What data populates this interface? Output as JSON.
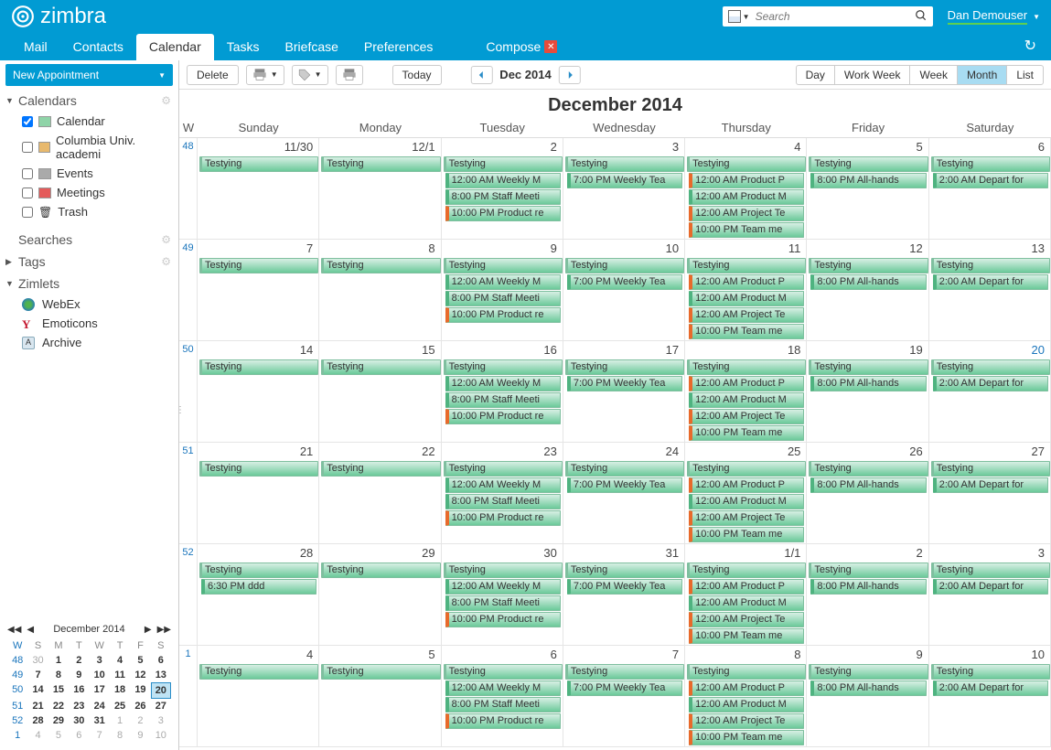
{
  "logo_text": "zimbra",
  "search": {
    "placeholder": "Search"
  },
  "user": {
    "name": "Dan Demouser"
  },
  "nav": {
    "mail": "Mail",
    "contacts": "Contacts",
    "calendar": "Calendar",
    "tasks": "Tasks",
    "briefcase": "Briefcase",
    "preferences": "Preferences",
    "compose": "Compose"
  },
  "new_appt": "New Appointment",
  "toolbar": {
    "delete": "Delete",
    "today": "Today",
    "month_label": "Dec 2014"
  },
  "views": {
    "day": "Day",
    "work_week": "Work Week",
    "week": "Week",
    "month": "Month",
    "list": "List"
  },
  "sidebar": {
    "calendars_header": "Calendars",
    "items": [
      {
        "label": "Calendar",
        "checked": true,
        "color": "#8fd4a8"
      },
      {
        "label": "Columbia Univ. academi",
        "checked": false,
        "color": "#e8b96d"
      },
      {
        "label": "Events",
        "checked": false,
        "color": "#aaaaaa"
      },
      {
        "label": "Meetings",
        "checked": false,
        "color": "#e45b5b"
      },
      {
        "label": "Trash",
        "checked": false,
        "color": "trash"
      }
    ],
    "searches": "Searches",
    "tags": "Tags",
    "zimlets": "Zimlets",
    "zimlet_items": [
      {
        "label": "WebEx",
        "icon": "globe"
      },
      {
        "label": "Emoticons",
        "icon": "yahoo"
      },
      {
        "label": "Archive",
        "icon": "archive"
      }
    ]
  },
  "mini": {
    "title": "December 2014",
    "head": [
      "W",
      "S",
      "M",
      "T",
      "W",
      "T",
      "F",
      "S"
    ],
    "rows": [
      {
        "wk": "48",
        "days": [
          {
            "n": "30",
            "m": true
          },
          {
            "n": "1",
            "b": true
          },
          {
            "n": "2",
            "b": true
          },
          {
            "n": "3",
            "b": true
          },
          {
            "n": "4",
            "b": true
          },
          {
            "n": "5",
            "b": true
          },
          {
            "n": "6",
            "b": true
          }
        ]
      },
      {
        "wk": "49",
        "days": [
          {
            "n": "7",
            "b": true
          },
          {
            "n": "8",
            "b": true
          },
          {
            "n": "9",
            "b": true
          },
          {
            "n": "10",
            "b": true
          },
          {
            "n": "11",
            "b": true
          },
          {
            "n": "12",
            "b": true
          },
          {
            "n": "13",
            "b": true
          }
        ]
      },
      {
        "wk": "50",
        "days": [
          {
            "n": "14",
            "b": true
          },
          {
            "n": "15",
            "b": true
          },
          {
            "n": "16",
            "b": true
          },
          {
            "n": "17",
            "b": true
          },
          {
            "n": "18",
            "b": true
          },
          {
            "n": "19",
            "b": true
          },
          {
            "n": "20",
            "b": true,
            "t": true
          }
        ]
      },
      {
        "wk": "51",
        "days": [
          {
            "n": "21",
            "b": true
          },
          {
            "n": "22",
            "b": true
          },
          {
            "n": "23",
            "b": true
          },
          {
            "n": "24",
            "b": true
          },
          {
            "n": "25",
            "b": true
          },
          {
            "n": "26",
            "b": true
          },
          {
            "n": "27",
            "b": true
          }
        ]
      },
      {
        "wk": "52",
        "days": [
          {
            "n": "28",
            "b": true
          },
          {
            "n": "29",
            "b": true
          },
          {
            "n": "30",
            "b": true
          },
          {
            "n": "31",
            "b": true
          },
          {
            "n": "1",
            "m": true
          },
          {
            "n": "2",
            "m": true
          },
          {
            "n": "3",
            "m": true
          }
        ]
      },
      {
        "wk": "1",
        "days": [
          {
            "n": "4",
            "m": true
          },
          {
            "n": "5",
            "m": true
          },
          {
            "n": "6",
            "m": true
          },
          {
            "n": "7",
            "m": true
          },
          {
            "n": "8",
            "m": true
          },
          {
            "n": "9",
            "m": true
          },
          {
            "n": "10",
            "m": true
          }
        ]
      }
    ]
  },
  "calendar": {
    "title": "December 2014",
    "day_headers": [
      "W",
      "Sunday",
      "Monday",
      "Tuesday",
      "Wednesday",
      "Thursday",
      "Friday",
      "Saturday"
    ],
    "weeks": [
      {
        "num": "48",
        "days": [
          {
            "d": "11/30",
            "ev": [
              {
                "t": "Testying",
                "k": "testying"
              }
            ]
          },
          {
            "d": "12/1",
            "ev": [
              {
                "t": "Testying",
                "k": "testying"
              }
            ]
          },
          {
            "d": "2",
            "ev": [
              {
                "t": "Testying",
                "k": "testying"
              },
              {
                "t": "12:00 AM Weekly M",
                "k": "green free"
              },
              {
                "t": "8:00 PM Staff Meeti",
                "k": "green free"
              },
              {
                "t": "10:00 PM Product re",
                "k": "green busy"
              }
            ]
          },
          {
            "d": "3",
            "ev": [
              {
                "t": "Testying",
                "k": "testying"
              },
              {
                "t": "7:00 PM Weekly Tea",
                "k": "green free"
              }
            ]
          },
          {
            "d": "4",
            "ev": [
              {
                "t": "Testying",
                "k": "testying"
              },
              {
                "t": "12:00 AM Product P",
                "k": "green busy"
              },
              {
                "t": "12:00 AM Product M",
                "k": "green free"
              },
              {
                "t": "12:00 AM Project Te",
                "k": "green busy"
              },
              {
                "t": "10:00 PM Team me",
                "k": "green busy"
              }
            ]
          },
          {
            "d": "5",
            "ev": [
              {
                "t": "Testying",
                "k": "testying"
              },
              {
                "t": "8:00 PM All-hands",
                "k": "green free"
              }
            ]
          },
          {
            "d": "6",
            "ev": [
              {
                "t": "Testying",
                "k": "testying"
              },
              {
                "t": "2:00 AM Depart for",
                "k": "green free"
              }
            ]
          }
        ]
      },
      {
        "num": "49",
        "days": [
          {
            "d": "7",
            "ev": [
              {
                "t": "Testying",
                "k": "testying"
              }
            ]
          },
          {
            "d": "8",
            "ev": [
              {
                "t": "Testying",
                "k": "testying"
              }
            ]
          },
          {
            "d": "9",
            "ev": [
              {
                "t": "Testying",
                "k": "testying"
              },
              {
                "t": "12:00 AM Weekly M",
                "k": "green free"
              },
              {
                "t": "8:00 PM Staff Meeti",
                "k": "green free"
              },
              {
                "t": "10:00 PM Product re",
                "k": "green busy"
              }
            ]
          },
          {
            "d": "10",
            "ev": [
              {
                "t": "Testying",
                "k": "testying"
              },
              {
                "t": "7:00 PM Weekly Tea",
                "k": "green free"
              }
            ]
          },
          {
            "d": "11",
            "ev": [
              {
                "t": "Testying",
                "k": "testying"
              },
              {
                "t": "12:00 AM Product P",
                "k": "green busy"
              },
              {
                "t": "12:00 AM Product M",
                "k": "green free"
              },
              {
                "t": "12:00 AM Project Te",
                "k": "green busy"
              },
              {
                "t": "10:00 PM Team me",
                "k": "green busy"
              }
            ]
          },
          {
            "d": "12",
            "ev": [
              {
                "t": "Testying",
                "k": "testying"
              },
              {
                "t": "8:00 PM All-hands",
                "k": "green free"
              }
            ]
          },
          {
            "d": "13",
            "ev": [
              {
                "t": "Testying",
                "k": "testying"
              },
              {
                "t": "2:00 AM Depart for",
                "k": "green free"
              }
            ]
          }
        ]
      },
      {
        "num": "50",
        "days": [
          {
            "d": "14",
            "ev": [
              {
                "t": "Testying",
                "k": "testying"
              }
            ]
          },
          {
            "d": "15",
            "ev": [
              {
                "t": "Testying",
                "k": "testying"
              }
            ]
          },
          {
            "d": "16",
            "ev": [
              {
                "t": "Testying",
                "k": "testying"
              },
              {
                "t": "12:00 AM Weekly M",
                "k": "green free"
              },
              {
                "t": "8:00 PM Staff Meeti",
                "k": "green free"
              },
              {
                "t": "10:00 PM Product re",
                "k": "green busy"
              }
            ]
          },
          {
            "d": "17",
            "ev": [
              {
                "t": "Testying",
                "k": "testying"
              },
              {
                "t": "7:00 PM Weekly Tea",
                "k": "green free"
              }
            ]
          },
          {
            "d": "18",
            "ev": [
              {
                "t": "Testying",
                "k": "testying"
              },
              {
                "t": "12:00 AM Product P",
                "k": "green busy"
              },
              {
                "t": "12:00 AM Product M",
                "k": "green free"
              },
              {
                "t": "12:00 AM Project Te",
                "k": "green busy"
              },
              {
                "t": "10:00 PM Team me",
                "k": "green busy"
              }
            ]
          },
          {
            "d": "19",
            "ev": [
              {
                "t": "Testying",
                "k": "testying"
              },
              {
                "t": "8:00 PM All-hands",
                "k": "green free"
              }
            ]
          },
          {
            "d": "20",
            "blue": true,
            "ev": [
              {
                "t": "Testying",
                "k": "testying"
              },
              {
                "t": "2:00 AM Depart for",
                "k": "green free"
              }
            ]
          }
        ]
      },
      {
        "num": "51",
        "days": [
          {
            "d": "21",
            "ev": [
              {
                "t": "Testying",
                "k": "testying"
              }
            ]
          },
          {
            "d": "22",
            "ev": [
              {
                "t": "Testying",
                "k": "testying"
              }
            ]
          },
          {
            "d": "23",
            "ev": [
              {
                "t": "Testying",
                "k": "testying"
              },
              {
                "t": "12:00 AM Weekly M",
                "k": "green free"
              },
              {
                "t": "8:00 PM Staff Meeti",
                "k": "green free"
              },
              {
                "t": "10:00 PM Product re",
                "k": "green busy"
              }
            ]
          },
          {
            "d": "24",
            "ev": [
              {
                "t": "Testying",
                "k": "testying"
              },
              {
                "t": "7:00 PM Weekly Tea",
                "k": "green free"
              }
            ]
          },
          {
            "d": "25",
            "ev": [
              {
                "t": "Testying",
                "k": "testying"
              },
              {
                "t": "12:00 AM Product P",
                "k": "green busy"
              },
              {
                "t": "12:00 AM Product M",
                "k": "green free"
              },
              {
                "t": "12:00 AM Project Te",
                "k": "green busy"
              },
              {
                "t": "10:00 PM Team me",
                "k": "green busy"
              }
            ]
          },
          {
            "d": "26",
            "ev": [
              {
                "t": "Testying",
                "k": "testying"
              },
              {
                "t": "8:00 PM All-hands",
                "k": "green free"
              }
            ]
          },
          {
            "d": "27",
            "ev": [
              {
                "t": "Testying",
                "k": "testying"
              },
              {
                "t": "2:00 AM Depart for",
                "k": "green free"
              }
            ]
          }
        ]
      },
      {
        "num": "52",
        "days": [
          {
            "d": "28",
            "ev": [
              {
                "t": "Testying",
                "k": "testying"
              },
              {
                "t": "6:30 PM ddd",
                "k": "green free"
              }
            ]
          },
          {
            "d": "29",
            "ev": [
              {
                "t": "Testying",
                "k": "testying"
              }
            ]
          },
          {
            "d": "30",
            "ev": [
              {
                "t": "Testying",
                "k": "testying"
              },
              {
                "t": "12:00 AM Weekly M",
                "k": "green free"
              },
              {
                "t": "8:00 PM Staff Meeti",
                "k": "green free"
              },
              {
                "t": "10:00 PM Product re",
                "k": "green busy"
              }
            ]
          },
          {
            "d": "31",
            "ev": [
              {
                "t": "Testying",
                "k": "testying"
              },
              {
                "t": "7:00 PM Weekly Tea",
                "k": "green free"
              }
            ]
          },
          {
            "d": "1/1",
            "ev": [
              {
                "t": "Testying",
                "k": "testying"
              },
              {
                "t": "12:00 AM Product P",
                "k": "green busy"
              },
              {
                "t": "12:00 AM Product M",
                "k": "green free"
              },
              {
                "t": "12:00 AM Project Te",
                "k": "green busy"
              },
              {
                "t": "10:00 PM Team me",
                "k": "green busy"
              }
            ]
          },
          {
            "d": "2",
            "ev": [
              {
                "t": "Testying",
                "k": "testying"
              },
              {
                "t": "8:00 PM All-hands",
                "k": "green free"
              }
            ]
          },
          {
            "d": "3",
            "ev": [
              {
                "t": "Testying",
                "k": "testying"
              },
              {
                "t": "2:00 AM Depart for",
                "k": "green free"
              }
            ]
          }
        ]
      },
      {
        "num": "1",
        "days": [
          {
            "d": "4",
            "ev": [
              {
                "t": "Testying",
                "k": "testying"
              }
            ]
          },
          {
            "d": "5",
            "ev": [
              {
                "t": "Testying",
                "k": "testying"
              }
            ]
          },
          {
            "d": "6",
            "ev": [
              {
                "t": "Testying",
                "k": "testying"
              },
              {
                "t": "12:00 AM Weekly M",
                "k": "green free"
              },
              {
                "t": "8:00 PM Staff Meeti",
                "k": "green free"
              },
              {
                "t": "10:00 PM Product re",
                "k": "green busy"
              }
            ]
          },
          {
            "d": "7",
            "ev": [
              {
                "t": "Testying",
                "k": "testying"
              },
              {
                "t": "7:00 PM Weekly Tea",
                "k": "green free"
              }
            ]
          },
          {
            "d": "8",
            "ev": [
              {
                "t": "Testying",
                "k": "testying"
              },
              {
                "t": "12:00 AM Product P",
                "k": "green busy"
              },
              {
                "t": "12:00 AM Product M",
                "k": "green free"
              },
              {
                "t": "12:00 AM Project Te",
                "k": "green busy"
              },
              {
                "t": "10:00 PM Team me",
                "k": "green busy"
              }
            ]
          },
          {
            "d": "9",
            "ev": [
              {
                "t": "Testying",
                "k": "testying"
              },
              {
                "t": "8:00 PM All-hands",
                "k": "green free"
              }
            ]
          },
          {
            "d": "10",
            "ev": [
              {
                "t": "Testying",
                "k": "testying"
              },
              {
                "t": "2:00 AM Depart for",
                "k": "green free"
              }
            ]
          }
        ]
      }
    ]
  }
}
